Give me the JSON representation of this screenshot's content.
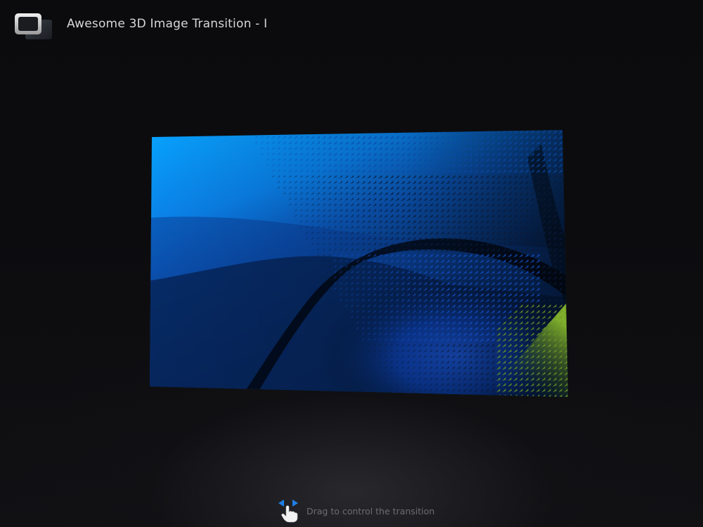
{
  "header": {
    "title": "Awesome 3D Image Transition - I",
    "logo_icon": "window-logo-icon"
  },
  "viewer": {
    "slide_icon": "transition-image-panel",
    "colors": {
      "sky_top": "#0aa0ff",
      "deep_blue": "#0a2a6a",
      "dark": "#02070f",
      "green_accent": "#7fa52a"
    }
  },
  "hint": {
    "text": "Drag to control the transition",
    "icon": "drag-hand-icon",
    "arrow_color": "#1e7fe6"
  }
}
